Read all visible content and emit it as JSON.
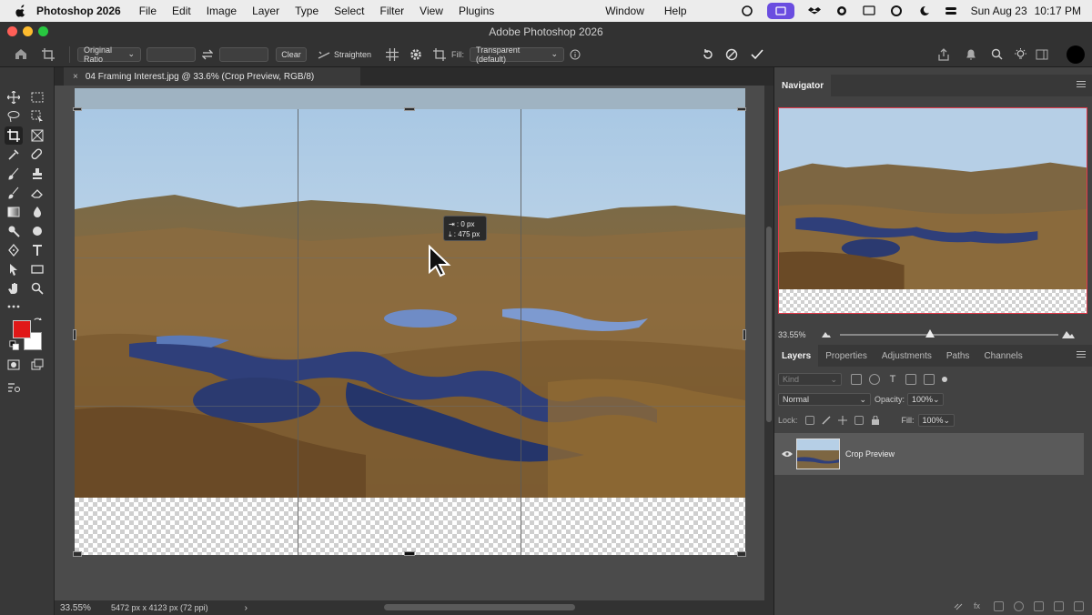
{
  "menubar": {
    "app_name": "Photoshop 2026",
    "menus": [
      "File",
      "Edit",
      "Image",
      "Layer",
      "Type",
      "Select",
      "Filter",
      "View",
      "Plugins"
    ],
    "right_menus": [
      "Window",
      "Help"
    ],
    "date": "Sun Aug 23",
    "time": "10:17 PM"
  },
  "titlebar": {
    "title": "Adobe Photoshop 2026"
  },
  "options": {
    "ratio": "Original Ratio",
    "clear_label": "Clear",
    "straighten_label": "Straighten",
    "fill_label": "Fill:",
    "fill_value": "Transparent (default)"
  },
  "document": {
    "tab_title": "04 Framing Interest.jpg @ 33.6% (Crop Preview, RGB/8)",
    "tab_close": "×",
    "tooltip_w": "0 px",
    "tooltip_h": ": 475 px"
  },
  "status": {
    "zoom": "33.55%",
    "doc_info": "5472 px x 4123 px (72 ppi)",
    "arrow": "›"
  },
  "navigator": {
    "tab": "Navigator",
    "zoom": "33.55%"
  },
  "layers_panel": {
    "tabs": [
      "Layers",
      "Properties",
      "Adjustments",
      "Paths",
      "Channels"
    ],
    "kind_placeholder": "Kind",
    "blend_mode": "Normal",
    "opacity_label": "Opacity:",
    "opacity_value": "100%",
    "lock_label": "Lock:",
    "fill_label": "Fill:",
    "fill_value": "100%",
    "layers": [
      {
        "name": "Crop Preview"
      }
    ]
  },
  "colors": {
    "foreground": "#e01818",
    "background": "#ffffff",
    "accent": "#6a4de0",
    "nav_frame": "#e23a4b"
  }
}
